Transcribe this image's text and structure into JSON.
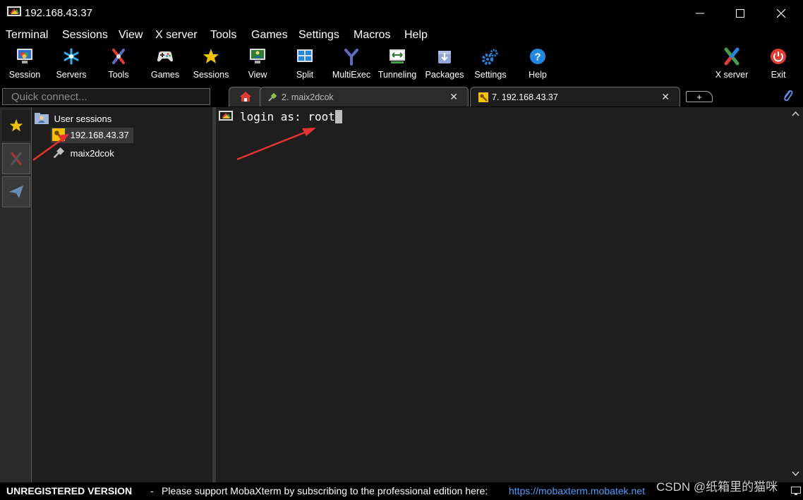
{
  "window": {
    "title": "192.168.43.37"
  },
  "menu": [
    "Terminal",
    "Sessions",
    "View",
    "X server",
    "Tools",
    "Games",
    "Settings",
    "Macros",
    "Help"
  ],
  "toolbar": [
    {
      "label": "Session",
      "icon": "session-monitor-icon"
    },
    {
      "label": "Servers",
      "icon": "servers-star-icon"
    },
    {
      "label": "Tools",
      "icon": "tools-icon"
    },
    {
      "label": "Games",
      "icon": "gamepad-icon"
    },
    {
      "label": "Sessions",
      "icon": "star-icon"
    },
    {
      "label": "View",
      "icon": "view-monitor-icon"
    },
    {
      "label": "Split",
      "icon": "split-icon"
    },
    {
      "label": "MultiExec",
      "icon": "multiexec-icon"
    },
    {
      "label": "Tunneling",
      "icon": "tunneling-icon"
    },
    {
      "label": "Packages",
      "icon": "packages-icon"
    },
    {
      "label": "Settings",
      "icon": "gears-icon"
    },
    {
      "label": "Help",
      "icon": "help-icon"
    }
  ],
  "toolbar_right": [
    {
      "label": "X server",
      "icon": "x-server-icon"
    },
    {
      "label": "Exit",
      "icon": "power-icon"
    }
  ],
  "quick_connect": {
    "placeholder": "Quick connect..."
  },
  "tabs": [
    {
      "label": "2.  maix2dcok",
      "active": false
    },
    {
      "label": "7.  192.168.43.37",
      "active": true
    }
  ],
  "sessions": {
    "folder": "User sessions",
    "items": [
      {
        "label": "192.168.43.37",
        "selected": true
      },
      {
        "label": "maix2dcok",
        "selected": false
      }
    ]
  },
  "terminal": {
    "prompt": "login as: root"
  },
  "status": {
    "unregistered": "UNREGISTERED VERSION",
    "dash": "-",
    "message": "Please support MobaXterm by subscribing to the professional edition here:",
    "link": "https://mobaxterm.mobatek.net",
    "watermark": "CSDN @纸箱里的猫咪"
  },
  "colors": {
    "accent": "#f2c200",
    "link": "#4a9eff",
    "annotation_arrow": "#e63232"
  }
}
